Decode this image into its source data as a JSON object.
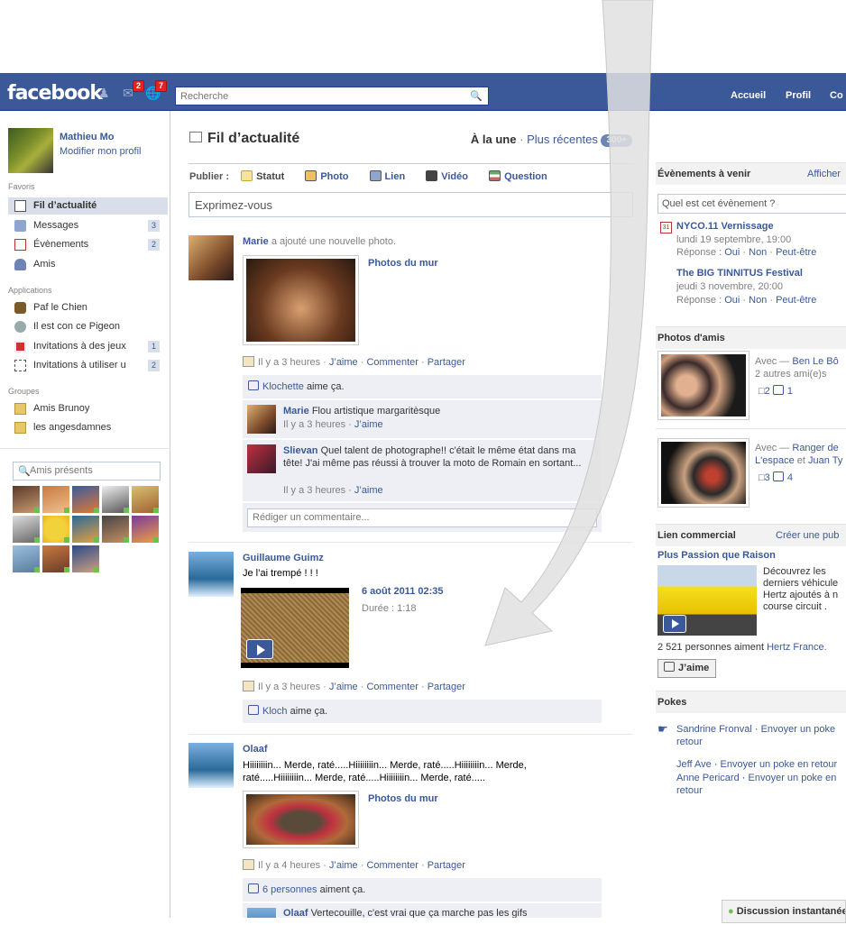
{
  "topbar": {
    "logo": "facebook",
    "friend_requests_count": "",
    "messages_count": "2",
    "notifications_count": "7",
    "search_placeholder": "Recherche",
    "nav": [
      "Accueil",
      "Profil",
      "Co"
    ]
  },
  "left": {
    "user_name": "Mathieu Mo",
    "edit_profile": "Modifier mon profil",
    "favorites_title": "Favoris",
    "favorites": [
      {
        "label": "Fil d’actualité",
        "count": ""
      },
      {
        "label": "Messages",
        "count": "3"
      },
      {
        "label": "Évènements",
        "count": "2"
      },
      {
        "label": "Amis",
        "count": ""
      }
    ],
    "apps_title": "Applications",
    "apps": [
      {
        "label": "Paf le Chien",
        "count": ""
      },
      {
        "label": "Il est con ce Pigeon",
        "count": ""
      },
      {
        "label": "Invitations à des jeux",
        "count": "1"
      },
      {
        "label": "Invitations à utiliser u",
        "count": "2"
      }
    ],
    "groups_title": "Groupes",
    "groups": [
      {
        "label": "Amis Brunoy"
      },
      {
        "label": "les angesdamnes"
      }
    ],
    "friends_search_placeholder": "Amis présents"
  },
  "main": {
    "title": "Fil d’actualité",
    "sort_top": "À la une",
    "sort_sep": "·",
    "sort_recent": "Plus récentes",
    "recent_count": "300+",
    "publish_label": "Publier :",
    "publish_options": [
      "Statut",
      "Photo",
      "Lien",
      "Vidéo",
      "Question"
    ],
    "composer_placeholder": "Exprimez-vous",
    "stories": [
      {
        "actor": "Marie",
        "action": "a ajouté une nouvelle photo.",
        "attachment_title": "Photos du mur",
        "time": "Il y a 3 heures",
        "like": "J’aime",
        "comment": "Commenter",
        "share": "Partager",
        "likers": "Klochette",
        "likes_suffix": "aime ça.",
        "comments": [
          {
            "author": "Marie",
            "text": "Flou artistique margaritèsque",
            "time": "Il y a 3 heures",
            "like": "J’aime"
          },
          {
            "author": "Slievan",
            "text": "Quel talent de photographe!! c'était le même état dans ma tête! J'ai même pas réussi à trouver la moto de Romain en sortant...",
            "time": "Il y a 3 heures",
            "like": "J’aime"
          }
        ],
        "comment_placeholder": "Rédiger un commentaire..."
      },
      {
        "actor": "Guillaume Guimz",
        "message": "Je l’ai trempé ! ! !",
        "video_date": "6 août 2011 02:35",
        "video_duration": "Durée : 1:18",
        "time": "Il y a 3 heures",
        "like": "J’aime",
        "comment": "Commenter",
        "share": "Partager",
        "likers": "Kloch",
        "likes_suffix": "aime ça."
      },
      {
        "actor": "Olaaf",
        "message": "Hiiiiiiiin... Merde, raté.....Hiiiiiiiin... Merde, raté.....Hiiiiiiiin... Merde, raté.....Hiiiiiiiin... Merde, raté.....Hiiiiiiiin... Merde, raté.....",
        "attachment_title": "Photos du mur",
        "time": "Il y a 4 heures",
        "like": "J’aime",
        "comment": "Commenter",
        "share": "Partager",
        "likers": "6 personnes",
        "likes_suffix": "aiment ça.",
        "comment_author": "Olaaf",
        "comment_text": "Vertecouille, c'est vrai que ça marche pas les gifs"
      }
    ]
  },
  "right": {
    "events_title": "Évènements à venir",
    "events_action": "Afficher",
    "events_input": "Quel est cet évènement ?",
    "events": [
      {
        "name": "NYCO.11 Vernissage",
        "date": "lundi 19 septembre, 19:00",
        "reply_label": "Réponse :",
        "yes": "Oui",
        "no": "Non",
        "maybe": "Peut-être"
      },
      {
        "name": "The BIG TINNITUS Festival",
        "date": "jeudi 3 novembre, 20:00",
        "reply_label": "Réponse :",
        "yes": "Oui",
        "no": "Non",
        "maybe": "Peut-être"
      }
    ],
    "calendar_day": "31",
    "photos_title": "Photos d'amis",
    "photos": [
      {
        "with": "Avec —",
        "name": "Ben Le Bô",
        "others": "2 autres ami(e)s",
        "comments": "2",
        "likes": "1"
      },
      {
        "with": "Avec —",
        "name": "Ranger de",
        "name2": "L'espace",
        "and": "et",
        "name3": "Juan Ty",
        "comments": "3",
        "likes": "4"
      }
    ],
    "ad_title": "Lien commercial",
    "ad_action": "Créer une pub",
    "ad_headline": "Plus Passion que Raison",
    "ad_text": [
      "Découvrez les",
      "derniers véhicule",
      "Hertz ajoutés à n",
      "course circuit ."
    ],
    "ad_likes": "2 521 personnes aiment",
    "ad_brand": "Hertz France.",
    "ad_like_button": "J’aime",
    "pokes_title": "Pokes",
    "pokes": [
      {
        "name": "Sandrine Fronval",
        "action": "Envoyer un poke",
        "action2": "retour"
      },
      {
        "name": "Jeff Ave",
        "action": "Envoyer un poke en retour"
      },
      {
        "name": "Anne Pericard",
        "action": "Envoyer un poke en",
        "action2": "retour"
      }
    ]
  },
  "chat": {
    "label": "Discussion instantanée"
  }
}
